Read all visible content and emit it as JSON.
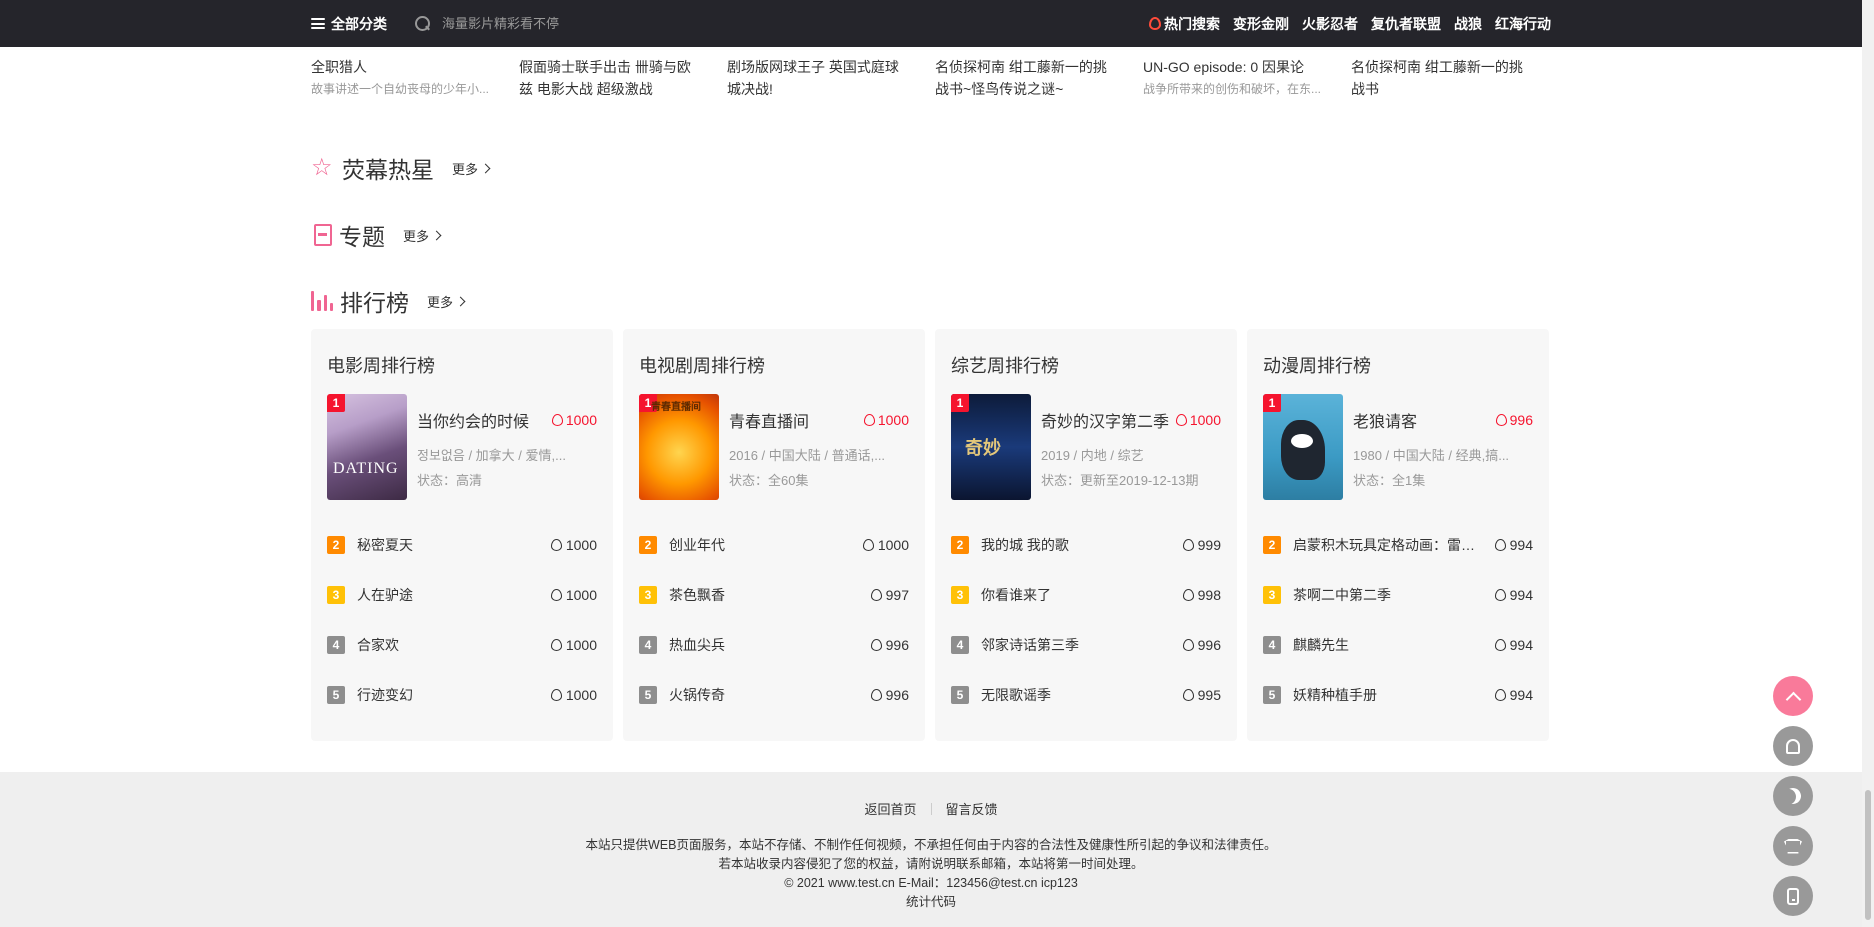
{
  "header": {
    "all_categories": "全部分类",
    "search_placeholder": "海量影片精彩看不停",
    "hot_label": "热门搜索",
    "hot_links": [
      "变形金刚",
      "火影忍者",
      "复仇者联盟",
      "战狼",
      "红海行动"
    ]
  },
  "prev_row": [
    {
      "title": "全职猎人",
      "sub": "故事讲述一个自幼丧母的少年小..."
    },
    {
      "title": "假面骑士联手出击 卌骑与欧\n兹 电影大战 超级激战",
      "sub": ""
    },
    {
      "title": "剧场版网球王子 英国式庭球\n城决战!",
      "sub": ""
    },
    {
      "title": "名侦探柯南 绀工藤新一的挑\n战书~怪鸟传说之谜~",
      "sub": ""
    },
    {
      "title": "UN-GO episode: 0 因果论",
      "sub": "战争所带来的创伤和破坏，在东..."
    },
    {
      "title": "名侦探柯南 绀工藤新一的挑\n战书",
      "sub": ""
    }
  ],
  "sections": {
    "stars": {
      "title": "荧幕热星",
      "more": "更多"
    },
    "topics": {
      "title": "专题",
      "more": "更多"
    },
    "ranking": {
      "title": "排行榜",
      "more": "更多"
    }
  },
  "ranks": [
    {
      "title": "电影周排行榜",
      "top": {
        "rank": "1",
        "name": "当你约会的时候",
        "heat": "1000",
        "meta": "정보없음 / 加拿大 / 爱情,...",
        "status": "状态：高清",
        "poster_text": "DATING"
      },
      "list": [
        {
          "rank": "2",
          "name": "秘密夏天",
          "heat": "1000"
        },
        {
          "rank": "3",
          "name": "人在驴途",
          "heat": "1000"
        },
        {
          "rank": "4",
          "name": "合家欢",
          "heat": "1000"
        },
        {
          "rank": "5",
          "name": "行迹变幻",
          "heat": "1000"
        }
      ]
    },
    {
      "title": "电视剧周排行榜",
      "top": {
        "rank": "1",
        "name": "青春直播间",
        "heat": "1000",
        "meta": "2016 / 中国大陆 / 普通话,...",
        "status": "状态：全60集",
        "poster_text": "青春直播间"
      },
      "list": [
        {
          "rank": "2",
          "name": "创业年代",
          "heat": "1000"
        },
        {
          "rank": "3",
          "name": "茶色飘香",
          "heat": "997"
        },
        {
          "rank": "4",
          "name": "热血尖兵",
          "heat": "996"
        },
        {
          "rank": "5",
          "name": "火锅传奇",
          "heat": "996"
        }
      ]
    },
    {
      "title": "综艺周排行榜",
      "top": {
        "rank": "1",
        "name": "奇妙的汉字第二季",
        "heat": "1000",
        "meta": "2019 / 内地 / 综艺",
        "status": "状态：更新至2019-12-13期",
        "poster_text": "奇妙"
      },
      "list": [
        {
          "rank": "2",
          "name": "我的城 我的歌",
          "heat": "999"
        },
        {
          "rank": "3",
          "name": "你看谁来了",
          "heat": "998"
        },
        {
          "rank": "4",
          "name": "邻家诗话第三季",
          "heat": "996"
        },
        {
          "rank": "5",
          "name": "无限歌谣季",
          "heat": "995"
        }
      ]
    },
    {
      "title": "动漫周排行榜",
      "top": {
        "rank": "1",
        "name": "老狼请客",
        "heat": "996",
        "meta": "1980 / 中国大陆 / 经典,搞...",
        "status": "状态：全1集",
        "poster_text": ""
      },
      "list": [
        {
          "rank": "2",
          "name": "启蒙积木玩具定格动画：雷霆...",
          "heat": "994"
        },
        {
          "rank": "3",
          "name": "茶啊二中第二季",
          "heat": "994"
        },
        {
          "rank": "4",
          "name": "麒麟先生",
          "heat": "994"
        },
        {
          "rank": "5",
          "name": "妖精种植手册",
          "heat": "994"
        }
      ]
    }
  ],
  "footer": {
    "home": "返回首页",
    "feedback": "留言反馈",
    "line1": "本站只提供WEB页面服务，本站不存储、不制作任何视频，不承担任何由于内容的合法性及健康性所引起的争议和法律责任。",
    "line2": "若本站收录内容侵犯了您的权益，请附说明联系邮箱，本站将第一时间处理。",
    "line3": "© 2021 www.test.cn  E-Mail：123456@test.cn  icp123",
    "line4": "统计代码"
  },
  "colors": {
    "accent": "#f06592",
    "rank1": "#f5142e",
    "rank2": "#ff8a00",
    "rank3": "#ffc107",
    "rank_other": "#8e8e8e",
    "topbar": "#25252b"
  }
}
